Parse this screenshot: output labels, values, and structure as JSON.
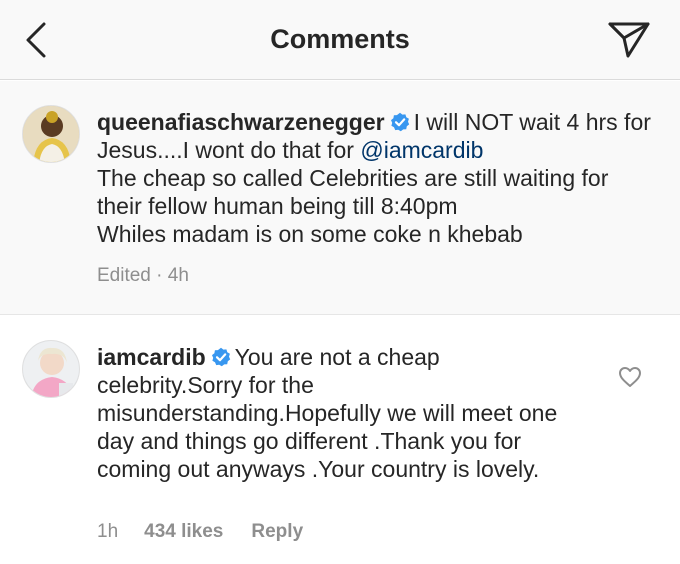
{
  "header": {
    "title": "Comments",
    "back_icon": "chevron-left-icon",
    "share_icon": "send-direct-icon"
  },
  "comments": [
    {
      "username": "queenafiaschwarzenegger",
      "verified": true,
      "text_1": "I will NOT wait 4 hrs for Jesus....I wont do that for ",
      "mention": "@iamcardib",
      "text_2": "The cheap so called Celebrities are still waiting for their fellow human being till 8:40pm",
      "text_3": "Whiles madam is on some coke n khebab",
      "meta": "Edited · 4h"
    },
    {
      "username": "iamcardib",
      "verified": true,
      "text": "You are not a cheap celebrity.Sorry for the misunderstanding.Hopefully we will meet one day and things go different .Thank you for coming out anyways .Your country is lovely.",
      "time": "1h",
      "likes": "434 likes",
      "reply": "Reply"
    }
  ],
  "colors": {
    "header_bg": "#f9f9f9",
    "text": "#262626",
    "meta": "#8e8e8e",
    "mention": "#003569",
    "verified": "#3897f0"
  }
}
